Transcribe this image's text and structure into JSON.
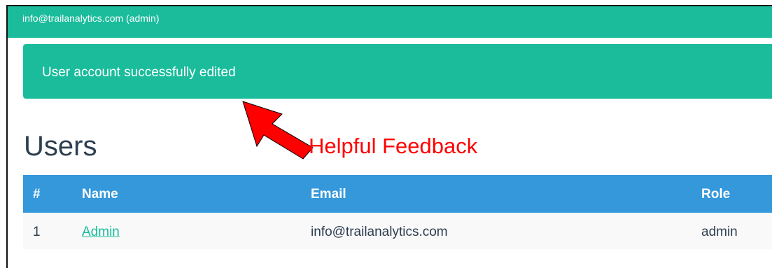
{
  "header": {
    "user_label": "info@trailanalytics.com (admin)"
  },
  "alert": {
    "message": "User account successfully edited"
  },
  "annotation": {
    "text": "Helpful Feedback"
  },
  "page": {
    "title": "Users"
  },
  "table": {
    "columns": [
      "#",
      "Name",
      "Email",
      "Role"
    ],
    "rows": [
      {
        "num": "1",
        "name": "Admin",
        "email": "info@trailanalytics.com",
        "role": "admin"
      }
    ]
  },
  "colors": {
    "brand": "#1abc9c",
    "table_header": "#3498db",
    "title_text": "#2c3e50",
    "annotation": "#ff0000"
  },
  "icons": {
    "arrow": "red-arrow-icon"
  }
}
